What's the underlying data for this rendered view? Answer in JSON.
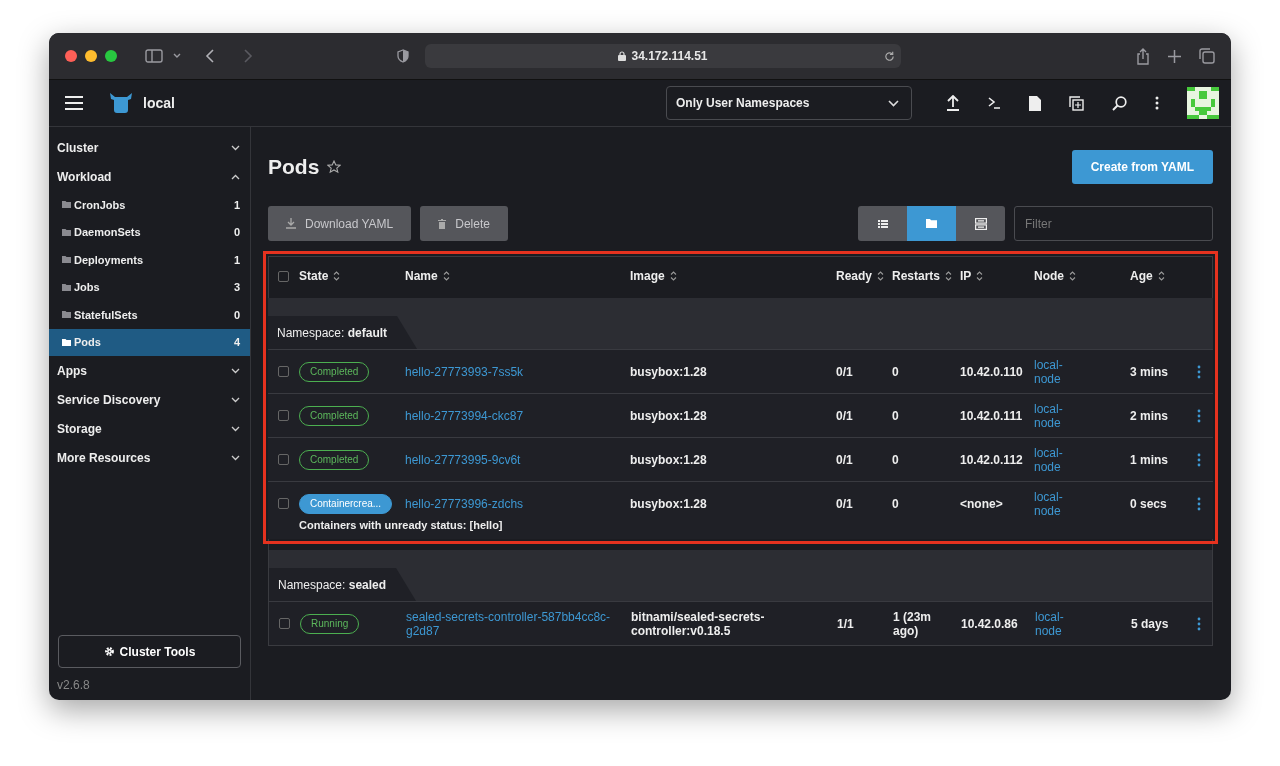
{
  "browser": {
    "url": "34.172.114.51"
  },
  "header": {
    "cluster": "local",
    "namespace_filter": "Only User Namespaces"
  },
  "sidebar": {
    "groups": [
      {
        "label": "Cluster",
        "expanded": false
      },
      {
        "label": "Workload",
        "expanded": true,
        "children": [
          {
            "label": "CronJobs",
            "count": "1",
            "selected": false
          },
          {
            "label": "DaemonSets",
            "count": "0",
            "selected": false
          },
          {
            "label": "Deployments",
            "count": "1",
            "selected": false
          },
          {
            "label": "Jobs",
            "count": "3",
            "selected": false
          },
          {
            "label": "StatefulSets",
            "count": "0",
            "selected": false
          },
          {
            "label": "Pods",
            "count": "4",
            "selected": true
          }
        ]
      },
      {
        "label": "Apps",
        "expanded": false
      },
      {
        "label": "Service Discovery",
        "expanded": false
      },
      {
        "label": "Storage",
        "expanded": false
      },
      {
        "label": "More Resources",
        "expanded": false
      }
    ],
    "cluster_tools": "Cluster Tools",
    "version": "v2.6.8"
  },
  "page": {
    "title": "Pods",
    "favorite": false,
    "create_button": "Create from YAML",
    "download_button": "Download YAML",
    "delete_button": "Delete",
    "view_modes": [
      {
        "kind": "list",
        "selected": false
      },
      {
        "kind": "folder",
        "selected": true
      },
      {
        "kind": "rows",
        "selected": false
      }
    ],
    "filter": {
      "placeholder": "Filter"
    }
  },
  "table": {
    "select_all_checked": false,
    "columns": [
      "State",
      "Name",
      "Image",
      "Ready",
      "Restarts",
      "IP",
      "Node",
      "Age"
    ],
    "groups": [
      {
        "prefix": "Namespace:",
        "namespace": "default",
        "highlighted": true,
        "rows": [
          {
            "checked": false,
            "state": "Completed",
            "kind": "done",
            "name": "hello-27773993-7ss5k",
            "image": "busybox:1.28",
            "ready": "0/1",
            "restarts": "0",
            "ip": "10.42.0.110",
            "node": "local-node",
            "age": "3 mins"
          },
          {
            "checked": false,
            "state": "Completed",
            "kind": "done",
            "name": "hello-27773994-ckc87",
            "image": "busybox:1.28",
            "ready": "0/1",
            "restarts": "0",
            "ip": "10.42.0.111",
            "node": "local-node",
            "age": "2 mins"
          },
          {
            "checked": false,
            "state": "Completed",
            "kind": "done",
            "name": "hello-27773995-9cv6t",
            "image": "busybox:1.28",
            "ready": "0/1",
            "restarts": "0",
            "ip": "10.42.0.112",
            "node": "local-node",
            "age": "1 mins"
          },
          {
            "checked": false,
            "state": "Containercrea...",
            "kind": "info",
            "name": "hello-27773996-zdchs",
            "image": "busybox:1.28",
            "ready": "0/1",
            "restarts": "0",
            "ip": "<none>",
            "node": "local-node",
            "age": "0 secs",
            "message": "Containers with unready status: [hello]"
          }
        ]
      },
      {
        "prefix": "Namespace:",
        "namespace": "sealed",
        "highlighted": false,
        "rows": [
          {
            "checked": false,
            "state": "Running",
            "kind": "done",
            "name": "sealed-secrets-controller-587bb4cc8c-g2d87",
            "image": "bitnami/sealed-secrets-controller:v0.18.5",
            "ready": "1/1",
            "restarts": "1 (23m ago)",
            "ip": "10.42.0.86",
            "node": "local-node",
            "age": "5 days"
          }
        ]
      }
    ]
  }
}
